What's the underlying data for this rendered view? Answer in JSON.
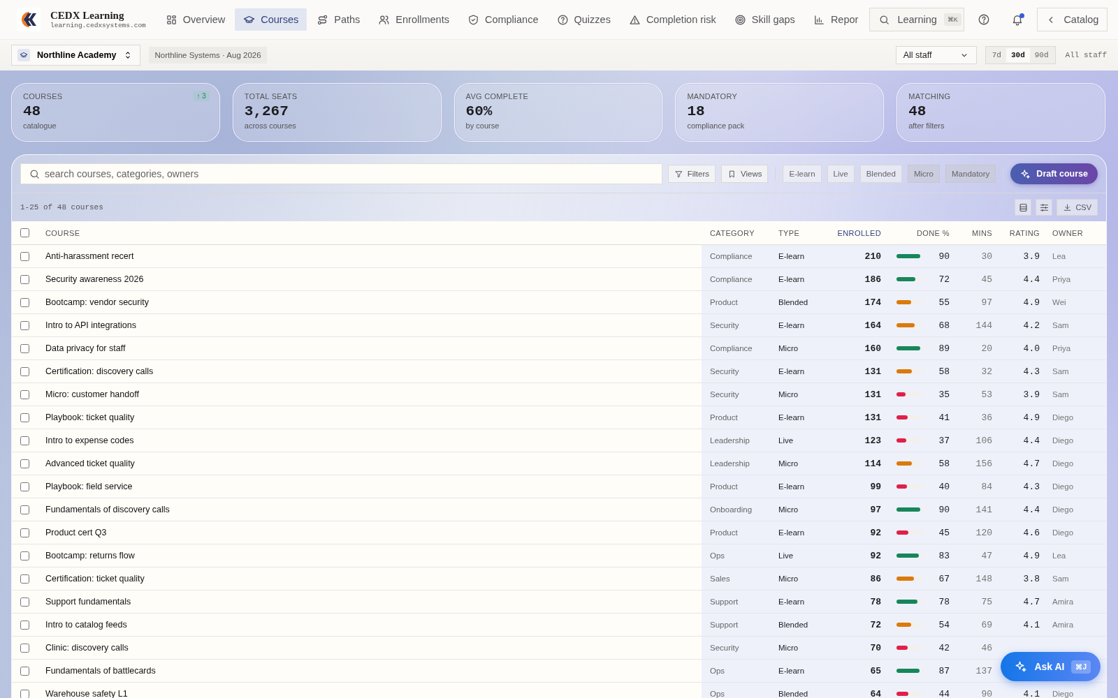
{
  "brand": {
    "title": "CEDX Learning",
    "url": "learning.cedxsystems.com"
  },
  "nav": [
    {
      "label": "Overview",
      "selected": false
    },
    {
      "label": "Courses",
      "selected": true
    },
    {
      "label": "Paths",
      "selected": false
    },
    {
      "label": "Enrollments",
      "selected": false
    },
    {
      "label": "Compliance",
      "selected": false
    },
    {
      "label": "Quizzes",
      "selected": false
    },
    {
      "label": "Completion risk",
      "selected": false
    },
    {
      "label": "Skill gaps",
      "selected": false
    },
    {
      "label": "Repor",
      "selected": false
    }
  ],
  "global_search": {
    "placeholder": "Learning",
    "shortcut": "⌘K"
  },
  "notifications": {
    "unread": true
  },
  "catalog_button": "Catalog",
  "academy": {
    "name": "Northline Academy"
  },
  "context_badge": "Northline Systems · Aug 2026",
  "staff_select": "All staff",
  "ranges": [
    {
      "label": "7d",
      "selected": false
    },
    {
      "label": "30d",
      "selected": true
    },
    {
      "label": "90d",
      "selected": false
    }
  ],
  "scope_label": "All staff",
  "stats": [
    {
      "label": "COURSES",
      "value": "48",
      "sub": "catalogue",
      "delta": "↑ 3"
    },
    {
      "label": "TOTAL SEATS",
      "value": "3,267",
      "sub": "across courses"
    },
    {
      "label": "AVG COMPLETE",
      "value": "60%",
      "sub": "by course"
    },
    {
      "label": "MANDATORY",
      "value": "18",
      "sub": "compliance pack"
    },
    {
      "label": "MATCHING",
      "value": "48",
      "sub": "after filters"
    }
  ],
  "toolbar": {
    "search_placeholder": "search courses, categories, owners",
    "filters": "Filters",
    "views": "Views",
    "chips": [
      {
        "label": "E-learn",
        "selected": false
      },
      {
        "label": "Live",
        "selected": false
      },
      {
        "label": "Blended",
        "selected": false
      },
      {
        "label": "Micro",
        "selected": true
      },
      {
        "label": "Mandatory",
        "selected": true
      }
    ],
    "draft_button": "Draft course"
  },
  "range_text": "1-25 of 48 courses",
  "csv_button": "CSV",
  "table": {
    "all_checked": false,
    "columns": [
      {
        "label": "COURSE",
        "sorted": false
      },
      {
        "label": "CATEGORY",
        "sorted": false
      },
      {
        "label": "TYPE",
        "sorted": false
      },
      {
        "label": "ENROLLED",
        "sorted": true
      },
      {
        "label": "DONE %",
        "sorted": false
      },
      {
        "label": "MINS",
        "sorted": false
      },
      {
        "label": "RATING",
        "sorted": false
      },
      {
        "label": "OWNER",
        "sorted": false
      }
    ],
    "rows": [
      {
        "checked": false,
        "course": "Anti-harassment recert",
        "category": "Compliance",
        "type": "E-learn",
        "enrolled": "210",
        "level": 0.9,
        "done": "90",
        "mins": "30",
        "rating": "3.9",
        "owner": "Lea"
      },
      {
        "checked": false,
        "course": "Security awareness 2026",
        "category": "Compliance",
        "type": "E-learn",
        "enrolled": "186",
        "level": 0.72,
        "done": "72",
        "mins": "45",
        "rating": "4.4",
        "owner": "Priya"
      },
      {
        "checked": false,
        "course": "Bootcamp: vendor security",
        "category": "Product",
        "type": "Blended",
        "enrolled": "174",
        "level": 0.55,
        "done": "55",
        "mins": "97",
        "rating": "4.9",
        "owner": "Wei"
      },
      {
        "checked": false,
        "course": "Intro to API integrations",
        "category": "Security",
        "type": "E-learn",
        "enrolled": "164",
        "level": 0.68,
        "done": "68",
        "mins": "144",
        "rating": "4.2",
        "owner": "Sam"
      },
      {
        "checked": false,
        "course": "Data privacy for staff",
        "category": "Compliance",
        "type": "Micro",
        "enrolled": "160",
        "level": 0.89,
        "done": "89",
        "mins": "20",
        "rating": "4.0",
        "owner": "Priya"
      },
      {
        "checked": false,
        "course": "Certification: discovery calls",
        "category": "Security",
        "type": "E-learn",
        "enrolled": "131",
        "level": 0.58,
        "done": "58",
        "mins": "32",
        "rating": "4.3",
        "owner": "Sam"
      },
      {
        "checked": false,
        "course": "Micro: customer handoff",
        "category": "Security",
        "type": "Micro",
        "enrolled": "131",
        "level": 0.35,
        "done": "35",
        "mins": "53",
        "rating": "3.9",
        "owner": "Sam"
      },
      {
        "checked": false,
        "course": "Playbook: ticket quality",
        "category": "Product",
        "type": "E-learn",
        "enrolled": "131",
        "level": 0.41,
        "done": "41",
        "mins": "36",
        "rating": "4.9",
        "owner": "Diego"
      },
      {
        "checked": false,
        "course": "Intro to expense codes",
        "category": "Leadership",
        "type": "Live",
        "enrolled": "123",
        "level": 0.37,
        "done": "37",
        "mins": "106",
        "rating": "4.4",
        "owner": "Diego"
      },
      {
        "checked": false,
        "course": "Advanced ticket quality",
        "category": "Leadership",
        "type": "Micro",
        "enrolled": "114",
        "level": 0.58,
        "done": "58",
        "mins": "156",
        "rating": "4.7",
        "owner": "Diego"
      },
      {
        "checked": false,
        "course": "Playbook: field service",
        "category": "Product",
        "type": "E-learn",
        "enrolled": "99",
        "level": 0.4,
        "done": "40",
        "mins": "84",
        "rating": "4.3",
        "owner": "Diego"
      },
      {
        "checked": false,
        "course": "Fundamentals of discovery calls",
        "category": "Onboarding",
        "type": "Micro",
        "enrolled": "97",
        "level": 0.9,
        "done": "90",
        "mins": "141",
        "rating": "4.4",
        "owner": "Diego"
      },
      {
        "checked": false,
        "course": "Product cert Q3",
        "category": "Product",
        "type": "E-learn",
        "enrolled": "92",
        "level": 0.45,
        "done": "45",
        "mins": "120",
        "rating": "4.6",
        "owner": "Diego"
      },
      {
        "checked": false,
        "course": "Bootcamp: returns flow",
        "category": "Ops",
        "type": "Live",
        "enrolled": "92",
        "level": 0.83,
        "done": "83",
        "mins": "47",
        "rating": "4.9",
        "owner": "Lea"
      },
      {
        "checked": false,
        "course": "Certification: ticket quality",
        "category": "Sales",
        "type": "Micro",
        "enrolled": "86",
        "level": 0.67,
        "done": "67",
        "mins": "148",
        "rating": "3.8",
        "owner": "Sam"
      },
      {
        "checked": false,
        "course": "Support fundamentals",
        "category": "Support",
        "type": "E-learn",
        "enrolled": "78",
        "level": 0.78,
        "done": "78",
        "mins": "75",
        "rating": "4.7",
        "owner": "Amira"
      },
      {
        "checked": false,
        "course": "Intro to catalog feeds",
        "category": "Support",
        "type": "Blended",
        "enrolled": "72",
        "level": 0.54,
        "done": "54",
        "mins": "69",
        "rating": "4.1",
        "owner": "Amira"
      },
      {
        "checked": false,
        "course": "Clinic: discovery calls",
        "category": "Security",
        "type": "Micro",
        "enrolled": "70",
        "level": 0.42,
        "done": "42",
        "mins": "46"
      },
      {
        "checked": false,
        "course": "Fundamentals of battlecards",
        "category": "Ops",
        "type": "E-learn",
        "enrolled": "65",
        "level": 0.87,
        "done": "87",
        "mins": "137"
      },
      {
        "checked": false,
        "course": "Warehouse safety L1",
        "category": "Ops",
        "type": "Blended",
        "enrolled": "64",
        "level": 0.44,
        "done": "44",
        "mins": "90",
        "rating": "4.1",
        "owner": "Diego"
      }
    ]
  },
  "ask_ai": {
    "label": "Ask AI",
    "shortcut": "⌘J"
  }
}
